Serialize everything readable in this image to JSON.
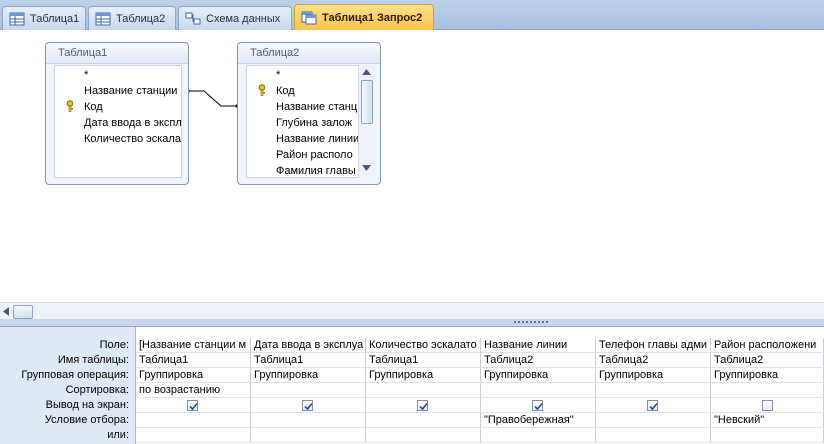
{
  "tabs": [
    {
      "label": "Таблица1",
      "icon": "table-icon"
    },
    {
      "label": "Таблица2",
      "icon": "table-icon"
    },
    {
      "label": "Схема данных",
      "icon": "relationships-icon"
    },
    {
      "label": "Таблица1 Запрос2",
      "icon": "query-icon",
      "active": true
    }
  ],
  "tables": [
    {
      "title": "Таблица1",
      "fields": [
        "*",
        "Название станции",
        "Код",
        "Дата ввода в экспл",
        "Количество эскала"
      ],
      "key_field": "Код"
    },
    {
      "title": "Таблица2",
      "fields": [
        "*",
        "Код",
        "Название станц",
        "Глубина залож",
        "Название линии",
        "Район располо",
        "Фамилия главы"
      ],
      "key_field": "Код"
    }
  ],
  "grid": {
    "row_labels": [
      "Поле:",
      "Имя таблицы:",
      "Групповая операция:",
      "Сортировка:",
      "Вывод на экран:",
      "Условие отбора:",
      "или:"
    ],
    "columns": [
      {
        "field": "[Название станции м",
        "table": "Таблица1",
        "group": "Группировка",
        "sort": "по возрастанию",
        "show": true,
        "criteria": "",
        "or": ""
      },
      {
        "field": "Дата ввода в эксплуа",
        "table": "Таблица1",
        "group": "Группировка",
        "sort": "",
        "show": true,
        "criteria": "",
        "or": ""
      },
      {
        "field": "Количество эскалато",
        "table": "Таблица1",
        "group": "Группировка",
        "sort": "",
        "show": true,
        "criteria": "",
        "or": ""
      },
      {
        "field": "Название линии",
        "table": "Таблица2",
        "group": "Группировка",
        "sort": "",
        "show": true,
        "criteria": "\"Правобережная\"",
        "or": ""
      },
      {
        "field": "Телефон главы адми",
        "table": "Таблица2",
        "group": "Группировка",
        "sort": "",
        "show": true,
        "criteria": "",
        "or": ""
      },
      {
        "field": "Район расположени",
        "table": "Таблица2",
        "group": "Группировка",
        "sort": "",
        "show": false,
        "criteria": "\"Невский\"",
        "or": ""
      }
    ]
  },
  "colors": {
    "active_tab": "#f9c44a",
    "tab_bar": "#bcd1ea",
    "label_column": "#dfe8f5"
  }
}
